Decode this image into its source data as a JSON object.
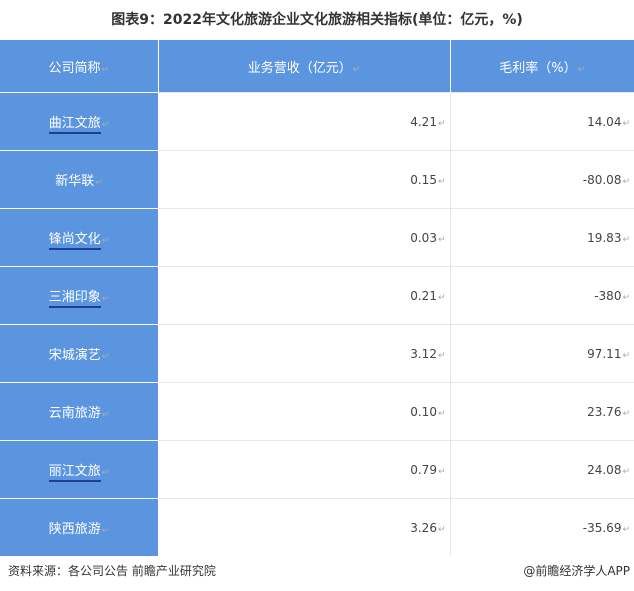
{
  "title": "图表9：2022年文化旅游企业文化旅游相关指标(单位：亿元，%)",
  "table": {
    "headers": [
      "公司简称",
      "业务营收（亿元）",
      "毛利率（%）"
    ],
    "rows": [
      {
        "name": "曲江文旅",
        "revenue": "4.21",
        "margin": "14.04"
      },
      {
        "name": "新华联",
        "revenue": "0.15",
        "margin": "-80.08"
      },
      {
        "name": "锋尚文化",
        "revenue": "0.03",
        "margin": "19.83"
      },
      {
        "name": "三湘印象",
        "revenue": "0.21",
        "margin": "-380"
      },
      {
        "name": "宋城演艺",
        "revenue": "3.12",
        "margin": "97.11"
      },
      {
        "name": "云南旅游",
        "revenue": "0.10",
        "margin": "23.76"
      },
      {
        "name": "丽江文旅",
        "revenue": "0.79",
        "margin": "24.08"
      },
      {
        "name": "陕西旅游",
        "revenue": "3.26",
        "margin": "-35.69"
      }
    ]
  },
  "footer": {
    "source": "资料来源：各公司公告 前瞻产业研究院",
    "credit": "@前瞻经济学人APP"
  },
  "colors": {
    "header_bg": "#5b95e0"
  }
}
